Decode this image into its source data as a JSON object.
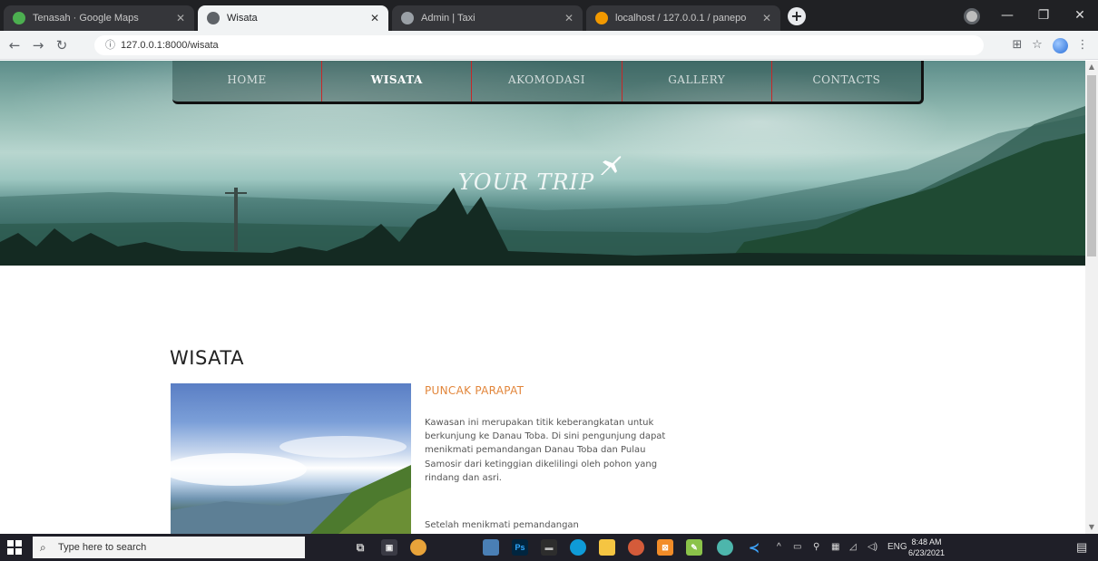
{
  "browser": {
    "tabs": [
      {
        "title": "Tenasah · Google Maps",
        "active": false,
        "favicon_color": "#4caf50"
      },
      {
        "title": "Wisata",
        "active": true,
        "favicon_color": "#5f6368"
      },
      {
        "title": "Admin | Taxi",
        "active": false,
        "favicon_color": "#9aa0a6"
      },
      {
        "title": "localhost / 127.0.0.1 / panepo",
        "active": false,
        "favicon_color": "#f29900"
      }
    ],
    "url": "127.0.0.1:8000/wisata"
  },
  "site": {
    "nav": [
      {
        "label": "HOME",
        "active": false
      },
      {
        "label": "WISATA",
        "active": true
      },
      {
        "label": "AKOMODASI",
        "active": false
      },
      {
        "label": "GALLERY",
        "active": false
      },
      {
        "label": "CONTACTS",
        "active": false
      }
    ],
    "brand": "YOUR TRIP"
  },
  "content": {
    "section_title": "WISATA",
    "card": {
      "title": "PUNCAK PARAPAT",
      "paragraph1": "Kawasan ini merupakan titik keberangkatan untuk berkunjung ke Danau Toba. Di sini pengunjung dapat menikmati pemandangan Danau Toba dan Pulau Samosir dari ketinggian dikelilingi oleh pohon yang rindang dan asri.",
      "paragraph2": "Setelah menikmati pemandangan"
    }
  },
  "taskbar": {
    "search_placeholder": "Type here to search",
    "language": "ENG",
    "time": "8:48 AM",
    "date": "6/23/2021"
  }
}
